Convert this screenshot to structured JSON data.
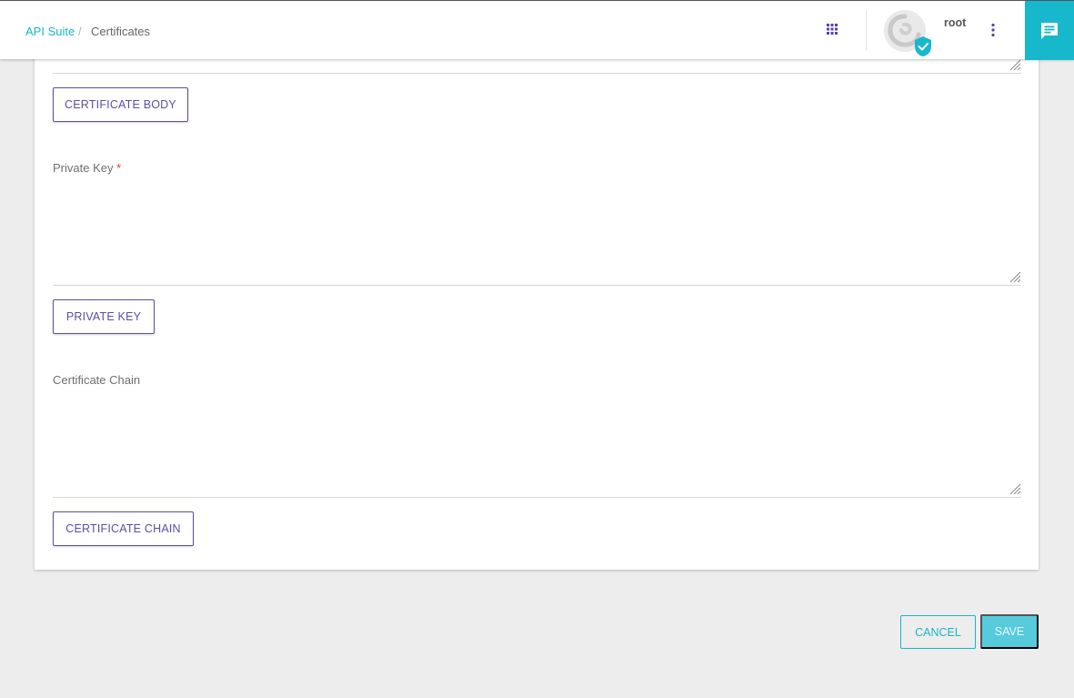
{
  "breadcrumb": {
    "parent": "API Suite",
    "separator": "/",
    "current": "Certificates"
  },
  "user": {
    "name": "root"
  },
  "icons": {
    "apps": "apps-grid-icon",
    "more": "more-vert-icon",
    "chat": "chat-icon",
    "verified": "verified-badge-icon"
  },
  "form": {
    "certificate_body": {
      "button": "CERTIFICATE BODY",
      "value": ""
    },
    "private_key": {
      "label": "Private Key",
      "required_mark": "*",
      "button": "PRIVATE KEY",
      "value": ""
    },
    "certificate_chain": {
      "label": "Certificate Chain",
      "button": "CERTIFICATE CHAIN",
      "value": ""
    }
  },
  "actions": {
    "cancel": "CANCEL",
    "save": "SAVE"
  },
  "colors": {
    "accent": "#19b6c8",
    "primary_purple": "#5a4ea8",
    "save_disabled": "#56cbdc",
    "background": "#ededed"
  }
}
